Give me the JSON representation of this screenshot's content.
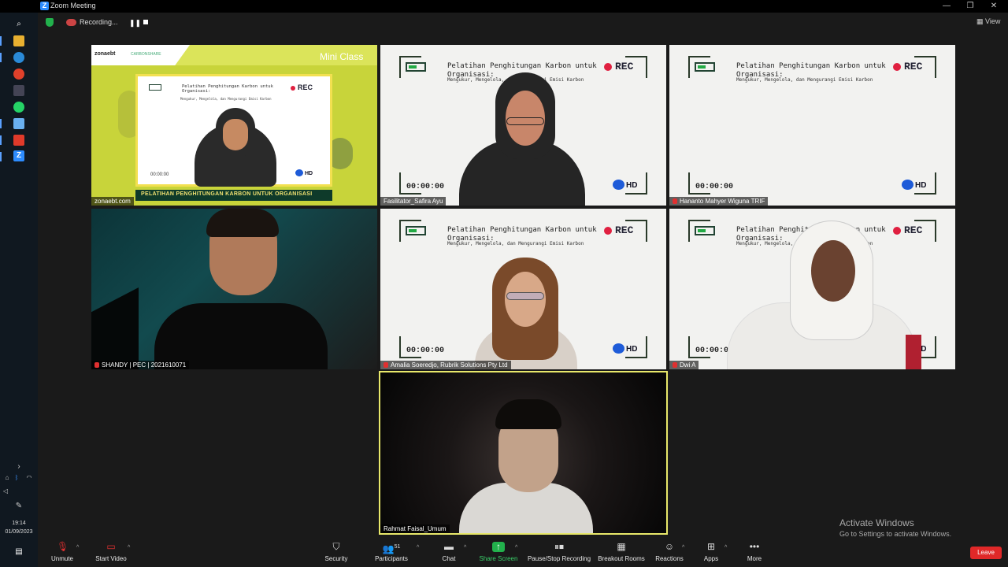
{
  "window": {
    "title": "Zoom Meeting",
    "min": "—",
    "max": "❐",
    "close": "✕"
  },
  "recording": {
    "status": "Recording..."
  },
  "view_label": "View",
  "taskbar": {
    "time": "19:14",
    "date": "01/09/2023"
  },
  "tiles": [
    {
      "name": "zonaebt.com",
      "brand": "zonaebt",
      "partner": "CARBONSHARE",
      "badge": "Mini Class",
      "banner": "PELATIHAN PENGHITUNGAN KARBON UNTUK ORGANISASI"
    },
    {
      "name": "Fasilitator_Safira Ayu"
    },
    {
      "name": "Hananto Mahyer Wiguna TRIF"
    },
    {
      "name": "SHANDY | PEC | 2021610071"
    },
    {
      "name": "Amalia Soeredjo, Rubrik Solutions Pty Ltd"
    },
    {
      "name": "Dwi A"
    },
    {
      "name": "Rahmat Faisal_Umum"
    }
  ],
  "slide": {
    "title": "Pelatihan Penghitungan Karbon untuk Organisasi:",
    "subtitle": "Mengukur, Mengelola, dan Mengurangi Emisi Karbon",
    "rec": "REC",
    "timer": "00:00:00",
    "hd": "HD"
  },
  "toolbar": {
    "unmute": "Unmute",
    "start_video": "Start Video",
    "security": "Security",
    "participants": "Participants",
    "participants_count": "51",
    "chat": "Chat",
    "share_screen": "Share Screen",
    "pause_recording": "Pause/Stop Recording",
    "breakout": "Breakout Rooms",
    "reactions": "Reactions",
    "apps": "Apps",
    "more": "More",
    "leave": "Leave"
  },
  "activate": {
    "title": "Activate Windows",
    "subtitle": "Go to Settings to activate Windows."
  },
  "colors": {
    "accent_green": "#22b14c",
    "zoom_blue": "#2d8cff",
    "leave_red": "#e02828",
    "active_speaker": "#e8e86a"
  }
}
